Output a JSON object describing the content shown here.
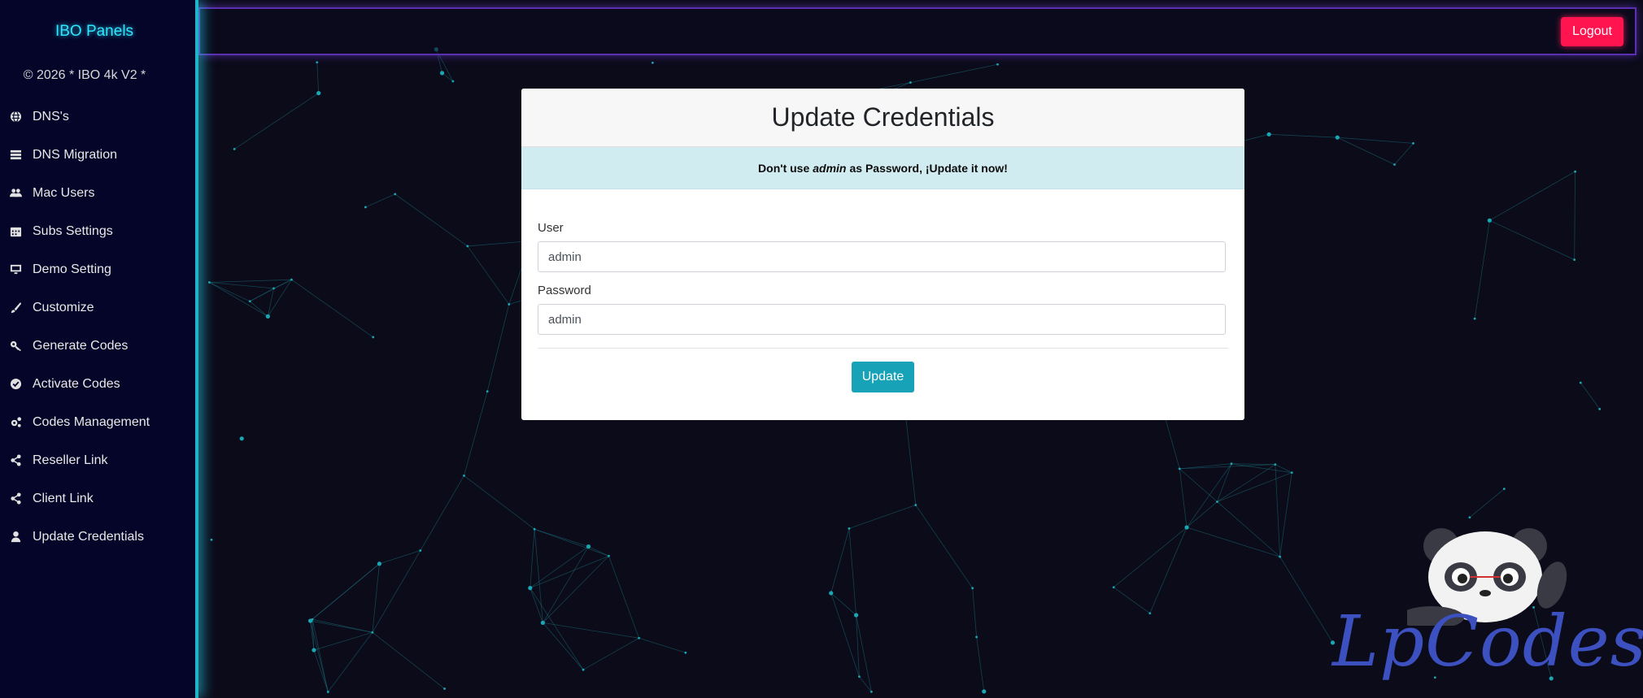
{
  "sidebar": {
    "brand": "IBO Panels",
    "copyright": "© 2026 * IBO 4k V2 *",
    "items": [
      {
        "label": "DNS's",
        "icon": "globe-icon"
      },
      {
        "label": "DNS Migration",
        "icon": "server-icon"
      },
      {
        "label": "Mac Users",
        "icon": "users-icon"
      },
      {
        "label": "Subs Settings",
        "icon": "calendar-icon"
      },
      {
        "label": "Demo Setting",
        "icon": "desktop-icon"
      },
      {
        "label": "Customize",
        "icon": "brush-icon"
      },
      {
        "label": "Generate Codes",
        "icon": "key-icon"
      },
      {
        "label": "Activate Codes",
        "icon": "check-circle-icon"
      },
      {
        "label": "Codes Management",
        "icon": "cogs-icon"
      },
      {
        "label": "Reseller Link",
        "icon": "share-icon"
      },
      {
        "label": "Client Link",
        "icon": "share-icon"
      },
      {
        "label": "Update Credentials",
        "icon": "user-icon"
      }
    ]
  },
  "topbar": {
    "logout_label": "Logout"
  },
  "card": {
    "title": "Update Credentials",
    "alert": {
      "prefix": "Don't use",
      "emph": "admin",
      "suffix": "as Password, ¡Update it now!"
    },
    "user_label": "User",
    "user_value": "admin",
    "password_label": "Password",
    "password_value": "admin",
    "update_label": "Update"
  },
  "watermark": {
    "text": "LpCodes"
  },
  "colors": {
    "brand": "#2ee6ff",
    "logout": "#ff1450",
    "update": "#17a2b8",
    "alert_bg": "#d1ecf1",
    "watermark": "#3c50c0"
  }
}
